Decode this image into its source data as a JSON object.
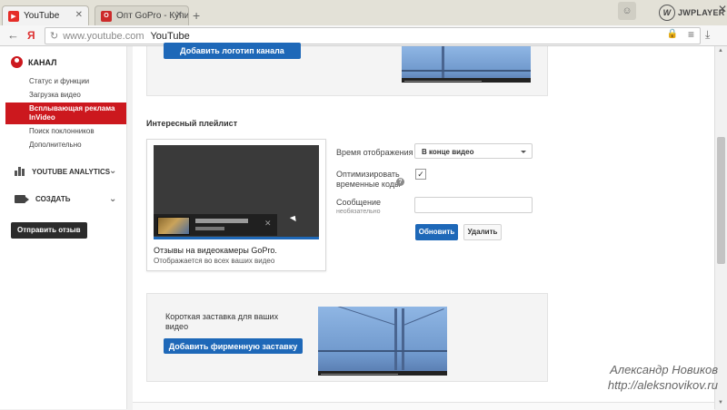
{
  "browser": {
    "tabs": [
      {
        "label": "YouTube",
        "favicon": "youtube-icon",
        "active": true
      },
      {
        "label": "Опт GoPro - Купить в",
        "favicon": "gopro-favicon",
        "active": false
      }
    ],
    "new_tab_glyph": "+",
    "jw_label": "JWPLAYER",
    "omnibox": {
      "url": "www.youtube.com",
      "title": "YouTube"
    },
    "back_glyph": "←",
    "home_glyph": "Я"
  },
  "sidebar": {
    "channel_label": "КАНАЛ",
    "items": [
      {
        "label": "Статус и функции"
      },
      {
        "label": "Загрузка видео"
      },
      {
        "label": "Всплывающая реклама InVideo",
        "active": true
      },
      {
        "label": "Поиск поклонников"
      },
      {
        "label": "Дополнительно"
      }
    ],
    "analytics_label": "YOUTUBE ANALYTICS",
    "create_label": "СОЗДАТЬ",
    "feedback_button": "Отправить отзыв"
  },
  "main": {
    "add_logo_button": "Добавить логотип канала",
    "playlist_section_title": "Интересный плейлист",
    "playlist_card": {
      "title": "Отзывы на видеокамеры GoPro.",
      "subtitle": "Отображается во всех ваших видео"
    },
    "form": {
      "display_time_label": "Время отображения",
      "display_time_value": "В конце видео",
      "optimize_label_1": "Оптимизировать",
      "optimize_label_2": "временные коды",
      "optimize_checked": true,
      "message_label": "Сообщение",
      "message_hint": "необязательно",
      "message_value": "",
      "update_button": "Обновить",
      "delete_button": "Удалить"
    },
    "branding": {
      "text": "Короткая заставка для ваших видео",
      "add_button": "Добавить фирменную заставку"
    }
  },
  "watermark": {
    "name": "Александр Новиков",
    "url": "http://aleksnovikov.ru"
  },
  "colors": {
    "accent_red": "#cc181e",
    "button_blue": "#1e68b8"
  }
}
